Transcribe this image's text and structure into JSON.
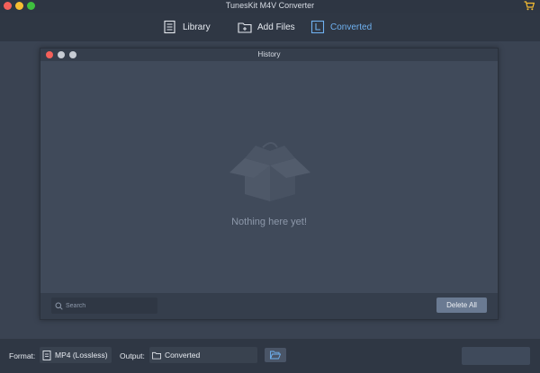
{
  "app": {
    "title": "TunesKit M4V Converter"
  },
  "toolbar": {
    "tabs": [
      {
        "label": "Library",
        "icon": "library-icon"
      },
      {
        "label": "Add Files",
        "icon": "add-files-icon"
      },
      {
        "label": "Converted",
        "icon": "converted-icon",
        "active": true
      }
    ]
  },
  "history_dialog": {
    "title": "History",
    "empty_message": "Nothing here yet!",
    "search_placeholder": "Search",
    "delete_all_label": "Delete All"
  },
  "bottom_bar": {
    "format_label": "Format:",
    "format_value": "MP4 (Lossless)",
    "output_label": "Output:",
    "output_value": "Converted"
  },
  "colors": {
    "accent": "#6fb1f0",
    "background": "#3a4352",
    "button": "#6a7a92"
  }
}
